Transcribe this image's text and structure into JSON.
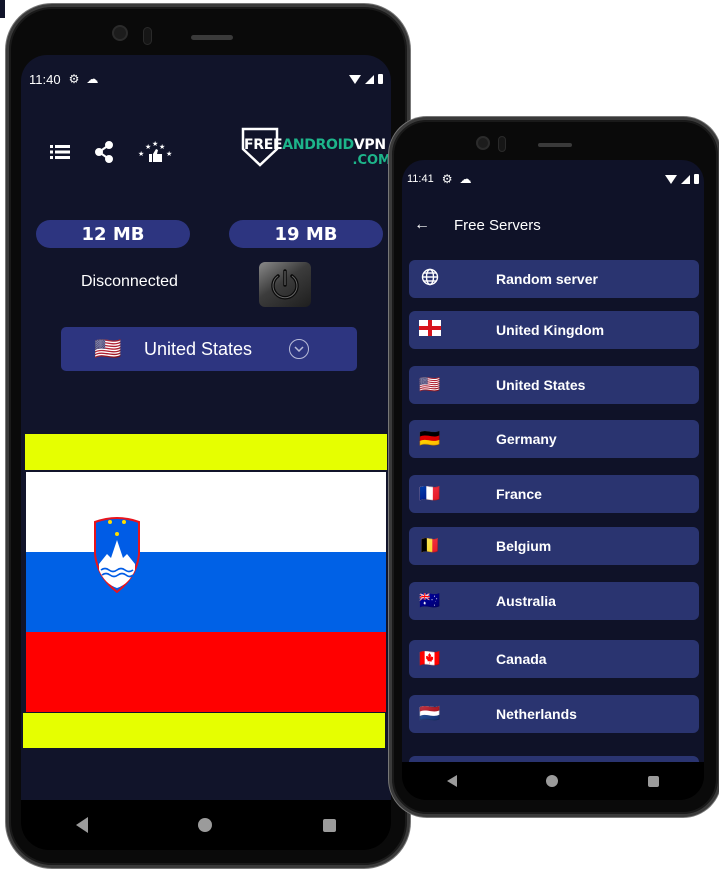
{
  "phone_main": {
    "status_bar": {
      "time": "11:40",
      "icons": [
        "gear-icon",
        "cloud-icon",
        "wifi-icon",
        "cellular-icon",
        "battery-icon"
      ]
    },
    "toolbar": {
      "icons": [
        "list-icon",
        "share-icon",
        "rate-stars-icon"
      ]
    },
    "logo": {
      "free": "FREE",
      "android": "ANDROID",
      "vpn": "VPN",
      "com": ".COM"
    },
    "download_stat": "12 MB",
    "upload_stat": "19 MB",
    "connection_status": "Disconnected",
    "power_button_icon": "power-icon",
    "country_selector": {
      "flag": "🇺🇸",
      "label": "United States",
      "icon": "chevron-down-circle-icon"
    },
    "displayed_flag": "Slovenia",
    "colors": {
      "accent": "#2d3580",
      "background": "#11142a",
      "highlight": "#e6ff00",
      "logo_green": "#1db58a"
    }
  },
  "phone_servers": {
    "status_bar": {
      "time": "11:41"
    },
    "header": {
      "back_icon": "←",
      "title": "Free Servers"
    },
    "servers": [
      {
        "flag": "🌐",
        "name": "Random server"
      },
      {
        "flag": "🏴",
        "name": "United Kingdom"
      },
      {
        "flag": "🇺🇸",
        "name": "United States"
      },
      {
        "flag": "🇩🇪",
        "name": "Germany"
      },
      {
        "flag": "🇫🇷",
        "name": "France"
      },
      {
        "flag": "🇧🇪",
        "name": "Belgium"
      },
      {
        "flag": "🇦🇺",
        "name": "Australia"
      },
      {
        "flag": "🇨🇦",
        "name": "Canada"
      },
      {
        "flag": "🇳🇱",
        "name": "Netherlands"
      },
      {
        "flag": "",
        "name": ""
      }
    ]
  }
}
